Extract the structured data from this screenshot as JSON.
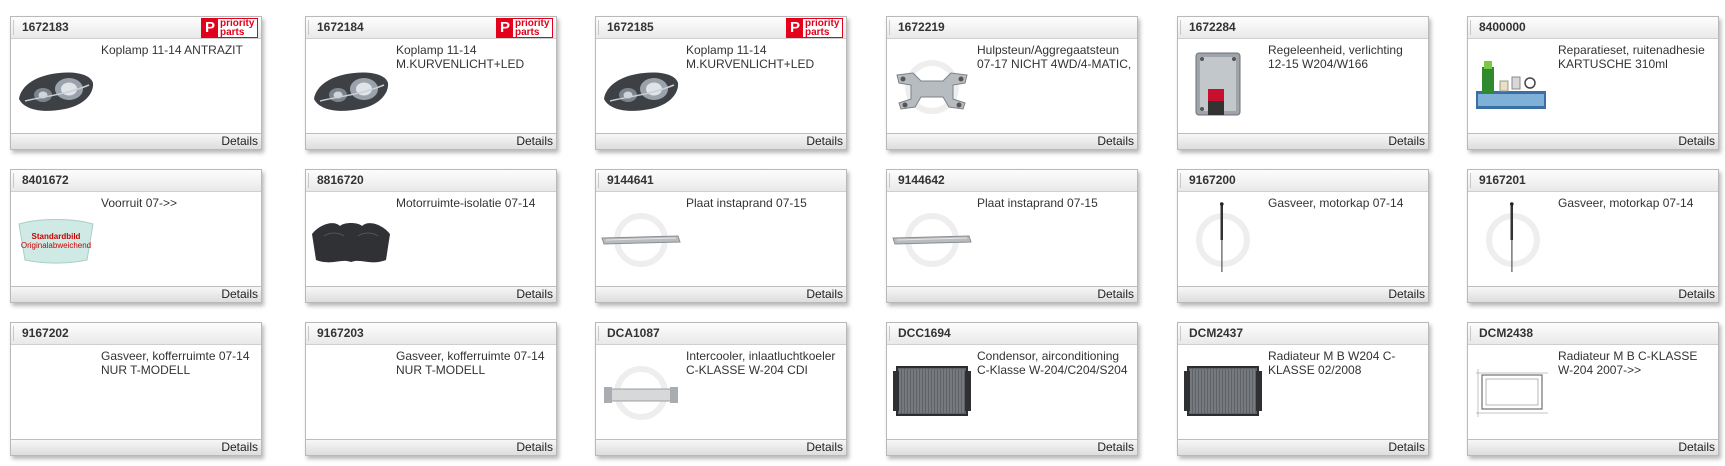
{
  "badge": {
    "text_line1": "priority",
    "text_line2": "parts"
  },
  "details_label": "Details",
  "placeholder_text": {
    "line1": "Standardbild",
    "line2": "Originalabweichend"
  },
  "cards": [
    {
      "id": "1672183",
      "desc1": "Koplamp 11-14 ANTRAZIT",
      "desc2": "",
      "badge": true,
      "img": "headlamp"
    },
    {
      "id": "1672184",
      "desc1": "Koplamp 11-14",
      "desc2": "M.KURVENLICHT+LED",
      "badge": true,
      "img": "headlamp"
    },
    {
      "id": "1672185",
      "desc1": "Koplamp 11-14",
      "desc2": "M.KURVENLICHT+LED",
      "badge": true,
      "img": "headlamp"
    },
    {
      "id": "1672219",
      "desc1": "Hulpsteun/Aggregaatsteun",
      "desc2": "07-17 NICHT 4WD/4-MATIC,",
      "badge": false,
      "img": "subframe"
    },
    {
      "id": "1672284",
      "desc1": "Regeleenheid, verlichting",
      "desc2": "12-15 W204/W166",
      "badge": false,
      "img": "ecu"
    },
    {
      "id": "8400000",
      "desc1": "Reparatieset, ruitenadhesie",
      "desc2": "KARTUSCHE 310ml",
      "badge": false,
      "img": "kit"
    },
    {
      "id": "8401672",
      "desc1": "Voorruit 07->>",
      "desc2": "",
      "badge": false,
      "img": "windshield"
    },
    {
      "id": "8816720",
      "desc1": "Motorruimte-isolatie 07-14",
      "desc2": "",
      "badge": false,
      "img": "insulation"
    },
    {
      "id": "9144641",
      "desc1": "Plaat instaprand 07-15",
      "desc2": "",
      "badge": false,
      "img": "plate"
    },
    {
      "id": "9144642",
      "desc1": "Plaat instaprand 07-15",
      "desc2": "",
      "badge": false,
      "img": "plate"
    },
    {
      "id": "9167200",
      "desc1": "Gasveer, motorkap 07-14",
      "desc2": "",
      "badge": false,
      "img": "strut"
    },
    {
      "id": "9167201",
      "desc1": "Gasveer, motorkap 07-14",
      "desc2": "",
      "badge": false,
      "img": "strut"
    },
    {
      "id": "9167202",
      "desc1": "Gasveer, kofferruimte 07-14",
      "desc2": "NUR T-MODELL",
      "badge": false,
      "img": "none"
    },
    {
      "id": "9167203",
      "desc1": "Gasveer, kofferruimte 07-14",
      "desc2": "NUR T-MODELL",
      "badge": false,
      "img": "none"
    },
    {
      "id": "DCA1087",
      "desc1": "Intercooler, inlaatluchtkoeler",
      "desc2": "C-KLASSE W-204 CDI",
      "badge": false,
      "img": "intercooler"
    },
    {
      "id": "DCC1694",
      "desc1": "Condensor, airconditioning",
      "desc2": "C-Klasse W-204/C204/S204",
      "badge": false,
      "img": "radiator"
    },
    {
      "id": "DCM2437",
      "desc1": "Radiateur M B W204 C-",
      "desc2": "KLASSE 02/2008",
      "badge": false,
      "img": "radiator"
    },
    {
      "id": "DCM2438",
      "desc1": "Radiateur M B C-KLASSE",
      "desc2": "W-204 2007->>",
      "badge": false,
      "img": "radiator-drawing"
    }
  ]
}
